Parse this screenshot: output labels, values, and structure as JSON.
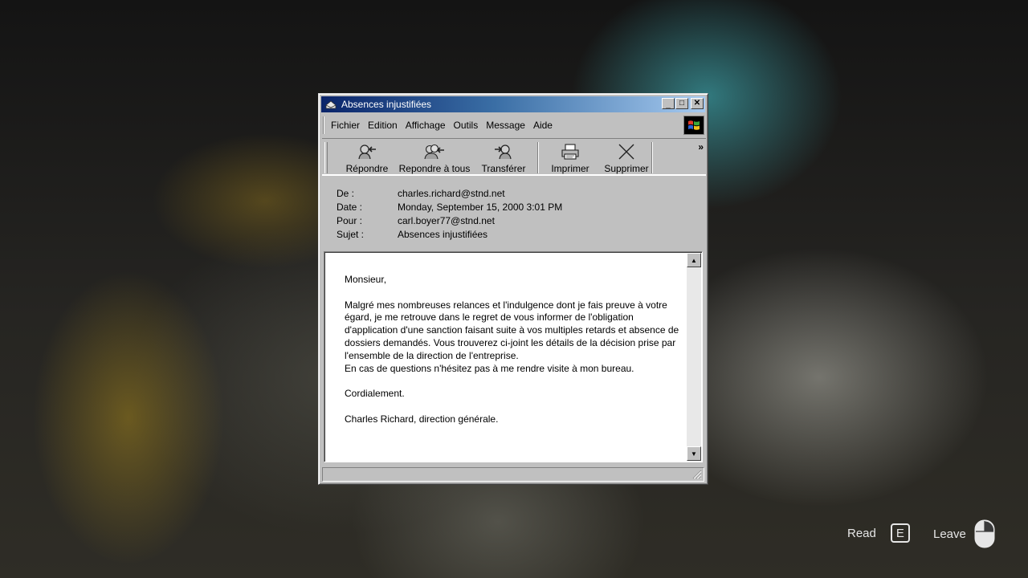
{
  "window": {
    "title": "Absences injustifiées",
    "controls": {
      "minimize": "_",
      "maximize": "□",
      "close": "✕"
    }
  },
  "menu": [
    "Fichier",
    "Edition",
    "Affichage",
    "Outils",
    "Message",
    "Aide"
  ],
  "toolbar": {
    "reply": "Répondre",
    "reply_all": "Repondre à tous",
    "forward": "Transférer",
    "print": "Imprimer",
    "delete": "Supprimer",
    "more": "»"
  },
  "headers": {
    "from_label": "De :",
    "from": "charles.richard@stnd.net",
    "date_label": "Date :",
    "date": "Monday, September 15, 2000 3:01 PM",
    "to_label": "Pour :",
    "to": "carl.boyer77@stnd.net",
    "subject_label": "Sujet :",
    "subject": "Absences injustifiées"
  },
  "body": {
    "greeting": "Monsieur,",
    "line1": "Malgré mes nombreuses relances et l'indulgence dont je fais preuve à votre",
    "line2": "égard, je me retrouve dans le regret de vous informer de l'obligation",
    "line3": "d'application d'une sanction faisant suite à vos multiples retards et absence de",
    "line4": "dossiers demandés. Vous trouverez ci-joint les détails de la décision prise par",
    "line5": "l'ensemble de la direction de l'entreprise.",
    "line6": "En cas de questions n'hésitez pas à me rendre visite à mon bureau.",
    "closing": "Cordialement.",
    "signature": "Charles Richard, direction générale."
  },
  "prompts": {
    "read_label": "Read",
    "read_key": "E",
    "leave_label": "Leave"
  }
}
